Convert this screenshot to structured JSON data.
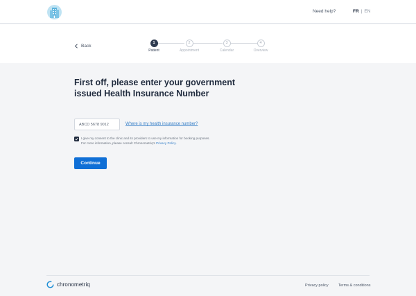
{
  "header": {
    "logo_icon": "clinic-building-icon",
    "help_label": "Need help?",
    "lang_fr": "FR",
    "lang_separator": "|",
    "lang_en": "EN"
  },
  "stepper": {
    "back_label": "Back",
    "steps": [
      {
        "number": "1",
        "label": "Patient",
        "active": true
      },
      {
        "number": "2",
        "label": "Appointment",
        "active": false
      },
      {
        "number": "3",
        "label": "Calendar",
        "active": false
      },
      {
        "number": "4",
        "label": "Overview",
        "active": false
      }
    ]
  },
  "form": {
    "heading": "First off, please enter your government issued Health Insurance Number",
    "hin_placeholder": "ABCD 5678 9012",
    "where_link": "Where is my health insurance number?",
    "consent_checked": true,
    "consent_text_line1": "I give my consent to the clinic and its providers to use my information for booking purposes.",
    "consent_text_line2": "For more information, please consult Chronometriq's",
    "consent_privacy_link": "Privacy Policy.",
    "continue_label": "Continue"
  },
  "footer": {
    "brand_name": "chronometriq",
    "privacy_label": "Privacy policy",
    "terms_label": "Terms & conditions"
  },
  "colors": {
    "accent": "#0f6fd6",
    "link": "#3b82c9",
    "dark": "#2e3a4f",
    "background": "#f4f5f7"
  }
}
